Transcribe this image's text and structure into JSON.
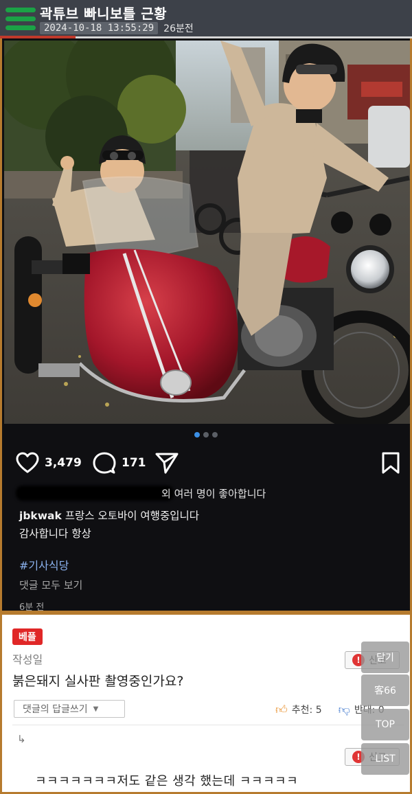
{
  "header": {
    "title": "곽튜브 빠니보틀 근황",
    "date": "2024-10-18 13:55:29",
    "ago": "26분전"
  },
  "post": {
    "carousel_total": 3,
    "carousel_active": 1,
    "likes_count": "3,479",
    "comments_count": "171",
    "liked_by_text": "외 여러 명이 좋아합니다",
    "username": "jbkwak",
    "caption_line1": "프랑스 오토바이 여행중입니다",
    "caption_line2": "감사합니다 항상",
    "hashtag": "#기사식당",
    "view_all_comments": "댓글 모두 보기",
    "posted_ago": "6분 전"
  },
  "comments": {
    "best_badge": "베플",
    "author_label": "작성일",
    "best_comment": "붉은돼지 실사판 촬영중인가요?",
    "report_label": "신고",
    "reply_button": "댓글의 답글쓰기",
    "upvote_label": "추천: 5",
    "downvote_label": "반대: 0",
    "reply_arrow": "↳",
    "reply_text": "ㅋㅋㅋㅋㅋㅋㅋ저도 같은 생각 했는데 ㅋㅋㅋㅋㅋ"
  },
  "floating": {
    "close": "닫기",
    "count": "客66",
    "top": "TOP",
    "list": "LIST"
  },
  "colors": {
    "header_bg": "#3d4149",
    "menu_green": "#1ba246",
    "insta_bg": "#0f0f12",
    "frame_border": "#b67b2e",
    "hashtag": "#8bb2ee",
    "best_badge": "#e02727",
    "sidecar_red": "#b01e2a"
  },
  "icons": {
    "menu": "hamburger-icon",
    "like": "heart-icon",
    "comment": "speech-bubble-icon",
    "share": "paper-plane-icon",
    "save": "bookmark-icon",
    "report": "exclamation-icon",
    "upvote": "thumbs-up-icon",
    "downvote": "thumbs-down-icon"
  }
}
